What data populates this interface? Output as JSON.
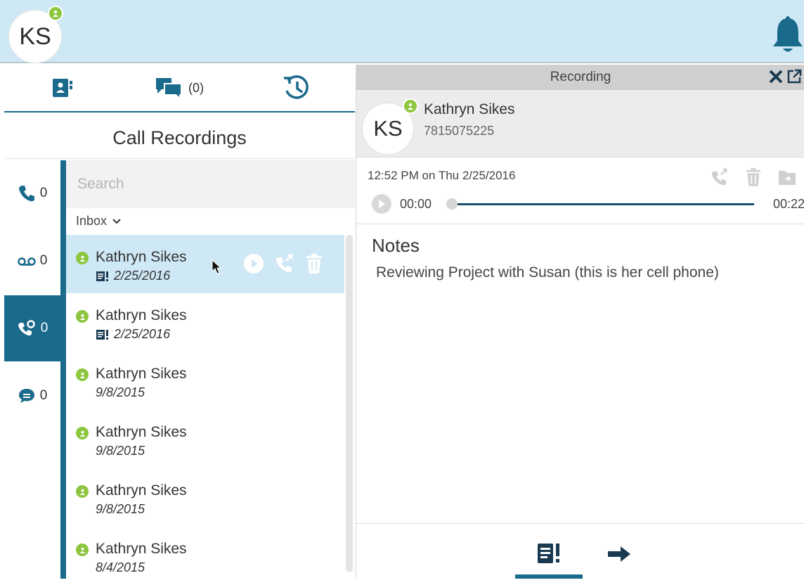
{
  "colors": {
    "accent": "#1a6a8b",
    "presence": "#8dc63f",
    "topbar": "#cfe8f5"
  },
  "user": {
    "initials": "KS",
    "presence_icon": "presence-icon"
  },
  "tabs": [
    {
      "label": "",
      "icon": "contacts-icon"
    },
    {
      "label": "(0)",
      "icon": "messages-icon"
    },
    {
      "label": "",
      "icon": "history-icon"
    }
  ],
  "section_title": "Call Recordings",
  "vnav": [
    {
      "icon": "phone-icon",
      "count": "0"
    },
    {
      "icon": "voicemail-icon",
      "count": "0"
    },
    {
      "icon": "call-recording-icon",
      "count": "0"
    },
    {
      "icon": "chat-icon",
      "count": "0"
    }
  ],
  "search": {
    "placeholder": "Search"
  },
  "folder": {
    "label": "Inbox"
  },
  "recordings": [
    {
      "name": "Kathryn Sikes",
      "date": "2/25/2016",
      "has_note": true
    },
    {
      "name": "Kathryn Sikes",
      "date": "2/25/2016",
      "has_note": true
    },
    {
      "name": "Kathryn Sikes",
      "date": "9/8/2015",
      "has_note": false
    },
    {
      "name": "Kathryn Sikes",
      "date": "9/8/2015",
      "has_note": false
    },
    {
      "name": "Kathryn Sikes",
      "date": "9/8/2015",
      "has_note": false
    },
    {
      "name": "Kathryn Sikes",
      "date": "8/4/2015",
      "has_note": false
    }
  ],
  "detail": {
    "header": "Recording",
    "contact": {
      "initials": "KS",
      "name": "Kathryn Sikes",
      "phone": "7815075225"
    },
    "timestamp": "12:52 PM on Thu 2/25/2016",
    "player": {
      "current": "00:00",
      "total": "00:22",
      "progress": 0
    },
    "notes_title": "Notes",
    "notes_text": "Reviewing Project with Susan (this is her cell phone)"
  }
}
